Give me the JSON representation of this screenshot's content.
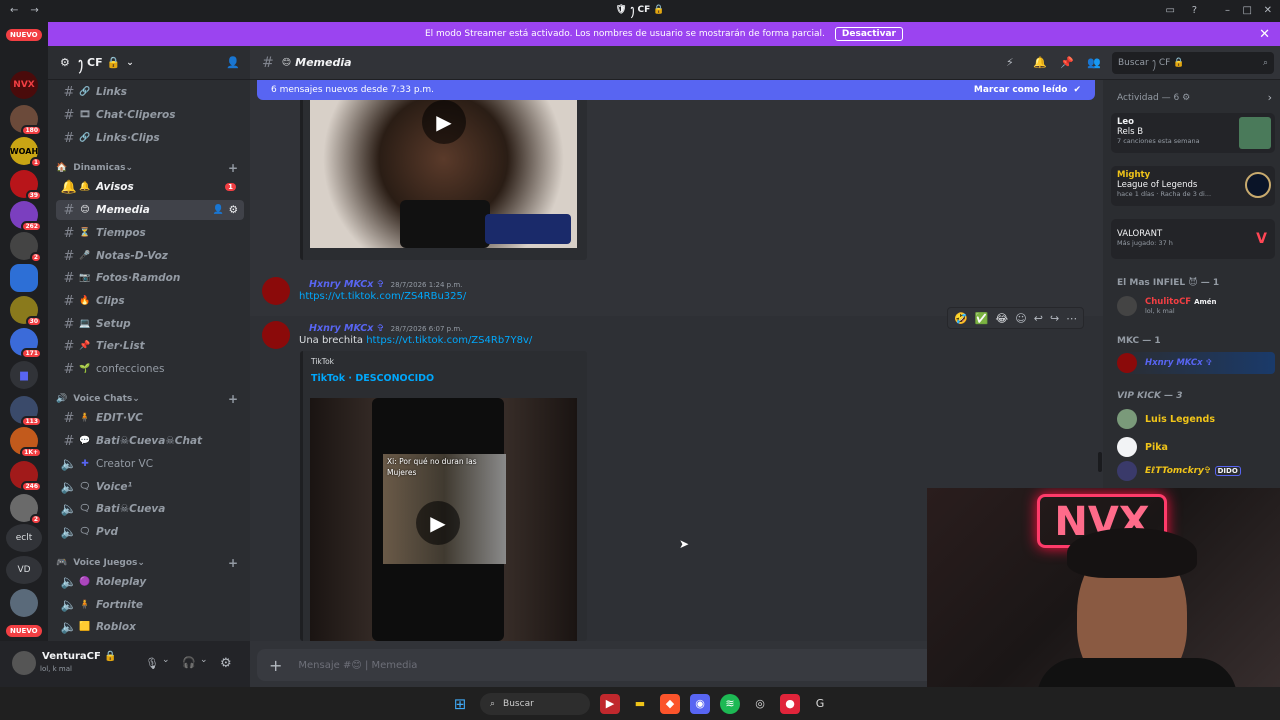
{
  "titlebar": {
    "title": "🛡 ꫂ CF 🔒",
    "back": "←",
    "forward": "→"
  },
  "banner": {
    "text": "El modo Streamer está activado. Los nombres de usuario se mostrarán de forma parcial.",
    "button": "Desactivar",
    "close": "✕"
  },
  "guilds": {
    "nuevo_top": "NUEVO",
    "nuevo_bottom": "NUEVO",
    "text_ecllt": "eclt",
    "text_vd": "VD",
    "badges": [
      "180",
      "1",
      "39",
      "262",
      "2",
      "30",
      "171",
      "113",
      "1K+",
      "246",
      "2"
    ]
  },
  "server": {
    "name": "ꫂ CF 🔒"
  },
  "channels": {
    "links": "Links",
    "chat_clipers": "Chat·Cliperos",
    "links_clips": "Links·Clips",
    "cat_dinamicas": "Dinamicas",
    "avisos": "Avisos",
    "avisos_badge": "1",
    "memedia": "Memedia",
    "tiempos": "Tiempos",
    "notas": "Notas-D-Voz",
    "fotos": "Fotos·Ramdon",
    "clips": "Clips",
    "setup": "Setup",
    "tierlist": "Tier·List",
    "confecciones": "confecciones",
    "cat_voice_chats": "Voice Chats",
    "edit_vc": "EDIT·VC",
    "bati_chat": "Bati☠Cueva☠Chat",
    "creator_vc": "Creator VC",
    "voice": "Voice¹",
    "bati_cueva": "Bati☠Cueva",
    "pvd": "Pvd",
    "cat_voice_juegos": "Voice Juegos",
    "roleplay": "Roleplay",
    "fortnite": "Fortnite",
    "roblox": "Roblox"
  },
  "user": {
    "name": "VenturaCF 🔒",
    "status": "lol, k mal"
  },
  "header": {
    "channel": "Memedia",
    "search_placeholder": "Buscar ꫂ CF 🔒"
  },
  "newbar": {
    "text": "6 mensajes nuevos desde 7:33 p.m.",
    "mark": "Marcar como leído"
  },
  "messages": [
    {
      "author": "Hxnry MKCx ✞",
      "time": "28/7/2026 1:24 p.m.",
      "link": "https://vt.tiktok.com/ZS4RBu325/"
    },
    {
      "author": "Hxnry MKCx ✞",
      "time": "28/7/2026 6:07 p.m.",
      "text": "Una brechita",
      "link": "https://vt.tiktok.com/ZS4Rb7Y8v/",
      "embed_provider": "TikTok",
      "embed_title": "TikTok · DESCONOCIDO",
      "video_caption": "Xi: Por qué no duran las Mujeres"
    }
  ],
  "composer": {
    "placeholder": "Mensaje #😊 | Memedia"
  },
  "members": {
    "activity_header": "Actividad — 6",
    "activities": [
      {
        "name": "Leo",
        "title": "Rels B",
        "sub": "7 canciones esta semana"
      },
      {
        "name": "Mighty",
        "title": "League of Legends",
        "sub": "hace 1 días · Racha de 3 di..."
      },
      {
        "name": "",
        "title": "VALORANT",
        "sub": "Más jugado: 37 h"
      }
    ],
    "group1": "El Mas INFIEL 😈 — 1",
    "member_chulito": "ChulitoCF",
    "member_chulito_tag": "Amén",
    "member_chulito_status": "lol, k mal",
    "group2": "MKC — 1",
    "member_hxnry": "Hxnry MKCx ✞",
    "group3": "VIP KICK — 3",
    "member_luis": "Luis Legends",
    "member_pika": "Pika",
    "member_eltom": "EℓTTomckry✞",
    "member_eltom_tag": "DIDO"
  },
  "taskbar": {
    "search": "Buscar"
  },
  "colors": {
    "accent": "#5865f2",
    "banner": "#9b44f0",
    "badge": "#f23f43"
  }
}
